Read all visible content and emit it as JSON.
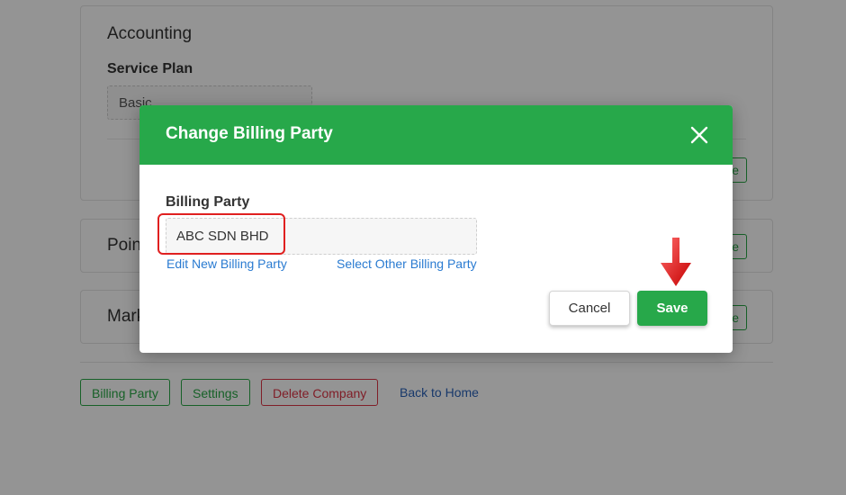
{
  "background": {
    "accounting": {
      "title": "Accounting",
      "service_plan_label": "Service Plan",
      "service_plan_value": "Basic"
    },
    "points_title": "Poin",
    "marketing_title": "Mark",
    "side_button_fragment": "e",
    "actions": {
      "billing_party": "Billing Party",
      "settings": "Settings",
      "delete_company": "Delete Company",
      "back_to_home": "Back to Home"
    }
  },
  "modal": {
    "title": "Change Billing Party",
    "close_icon": "close-icon",
    "billing_party_label": "Billing Party",
    "billing_party_value": "ABC SDN BHD",
    "edit_link": "Edit New Billing Party",
    "select_link": "Select Other Billing Party",
    "cancel_label": "Cancel",
    "save_label": "Save"
  },
  "annotations": {
    "highlight_color": "#e02020",
    "arrow_icon": "red-down-arrow-icon"
  },
  "colors": {
    "primary_green": "#27a84a",
    "danger_red": "#dc3545",
    "link_blue": "#2a7bd1"
  }
}
